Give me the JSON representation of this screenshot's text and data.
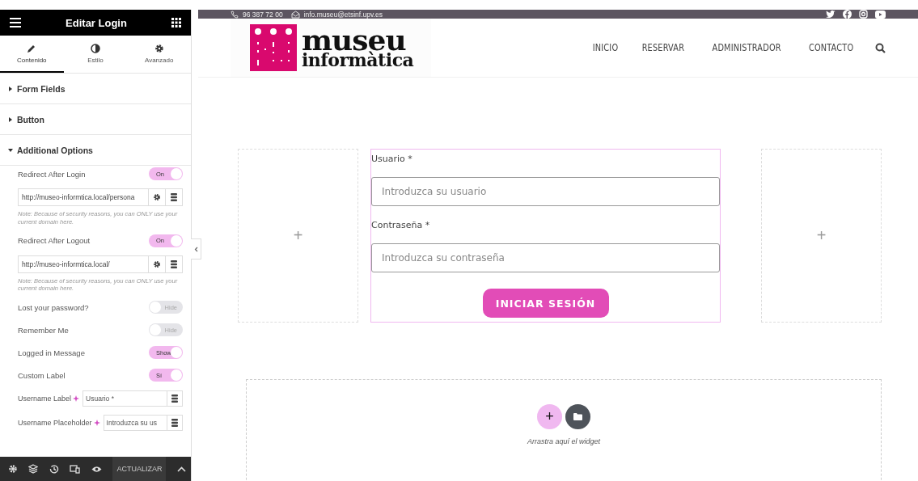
{
  "panel": {
    "title": "Editar Login",
    "tabs": [
      {
        "label": "Contenido",
        "selected": true
      },
      {
        "label": "Estilo",
        "selected": false
      },
      {
        "label": "Avanzado",
        "selected": false
      }
    ],
    "sections": [
      {
        "title": "Form Fields",
        "expanded": false
      },
      {
        "title": "Button",
        "expanded": false
      },
      {
        "title": "Additional Options",
        "expanded": true
      }
    ],
    "controls": [
      {
        "kind": "toggle",
        "label": "Redirect After Login",
        "state": "On",
        "on": true
      },
      {
        "kind": "url",
        "value": "http://museo-informtica.local/persona"
      },
      {
        "kind": "note",
        "text": "Note: Because of security reasons, you can ONLY use your current domain here."
      },
      {
        "kind": "toggle",
        "label": "Redirect After Logout",
        "state": "On",
        "on": true
      },
      {
        "kind": "url",
        "value": "http://museo-informtica.local/"
      },
      {
        "kind": "note",
        "text": "Note: Because of security reasons, you can ONLY use your current domain here."
      },
      {
        "kind": "toggle",
        "label": "Lost your password?",
        "state": "Hide",
        "on": false
      },
      {
        "kind": "toggle",
        "label": "Remember Me",
        "state": "Hide",
        "on": false
      },
      {
        "kind": "toggle",
        "label": "Logged in Message",
        "state": "Show",
        "on": true
      },
      {
        "kind": "toggle",
        "label": "Custom Label",
        "state": "Sí",
        "on": true
      },
      {
        "kind": "field",
        "label": "Username Label",
        "value": "Usuario *"
      },
      {
        "kind": "field",
        "label": "Username Placeholder",
        "value": "Introduzca su us"
      }
    ],
    "update_button": "ACTUALIZAR"
  },
  "site": {
    "phone": "96 387 72 00",
    "email": "info.museu@etsinf.upv.es",
    "logo": {
      "line1": "museu",
      "line2": "informàtica"
    },
    "nav": [
      "INICIO",
      "RESERVAR",
      "ADMINISTRADOR",
      "CONTACTO"
    ],
    "empty_column_plus": [
      "+",
      "+"
    ],
    "form": {
      "user_label": "Usuario *",
      "user_placeholder": "Introduzca su usuario",
      "pass_label": "Contraseña *",
      "pass_placeholder": "Introduzca su contraseña",
      "submit": "INICIAR SESIÓN"
    },
    "dropzone": {
      "add": "+",
      "hint": "Arrastra aquí el widget"
    }
  }
}
